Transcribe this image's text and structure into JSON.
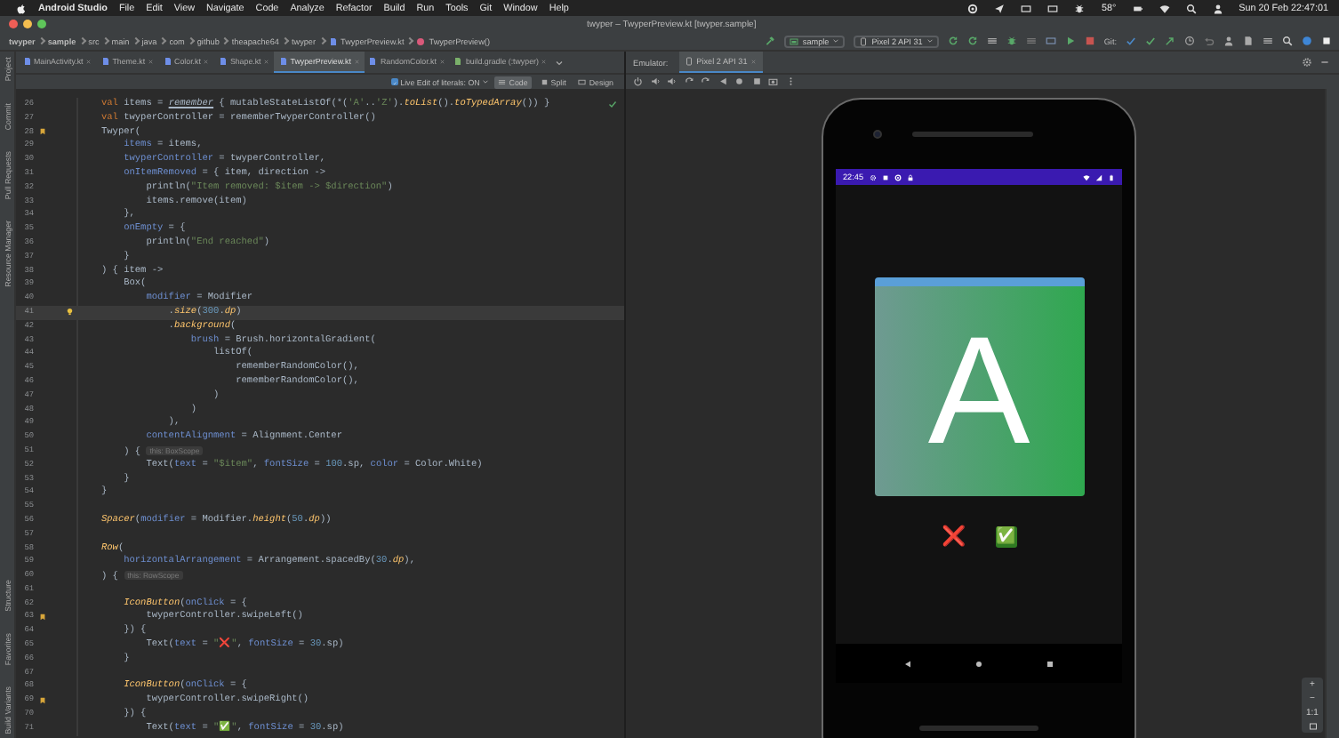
{
  "menubar": {
    "app": "Android Studio",
    "items": [
      "File",
      "Edit",
      "View",
      "Navigate",
      "Code",
      "Analyze",
      "Refactor",
      "Build",
      "Run",
      "Tools",
      "Git",
      "Window",
      "Help"
    ],
    "status_text": "58°",
    "clock": "Sun 20 Feb 22:47:01"
  },
  "window": {
    "title": "twyper – TwyperPreview.kt [twyper.sample]"
  },
  "breadcrumb": [
    "twyper",
    "sample",
    "src",
    "main",
    "java",
    "com",
    "github",
    "theapache64",
    "twyper",
    "TwyperPreview.kt",
    "TwyperPreview()"
  ],
  "run_config": {
    "module": "sample",
    "device": "Pixel 2 API 31",
    "vcs_label": "Git:"
  },
  "tool_strip": {
    "top": [
      "Project",
      "Commit",
      "Pull Requests",
      "Resource Manager"
    ],
    "bottom": [
      "Structure",
      "Favorites",
      "Build Variants"
    ]
  },
  "tabs": [
    {
      "label": "MainActivity.kt",
      "kind": "source",
      "selected": false
    },
    {
      "label": "Theme.kt",
      "kind": "source",
      "selected": false
    },
    {
      "label": "Color.kt",
      "kind": "source",
      "selected": false
    },
    {
      "label": "Shape.kt",
      "kind": "source",
      "selected": false
    },
    {
      "label": "TwyperPreview.kt",
      "kind": "source",
      "selected": true
    },
    {
      "label": "RandomColor.kt",
      "kind": "source",
      "selected": false
    },
    {
      "label": "build.gradle (:twyper)",
      "kind": "gradle",
      "selected": false
    }
  ],
  "editor_toolbar": {
    "live_edit": {
      "label": "Live Edit of literals: ON",
      "checked": true
    },
    "modes": [
      {
        "label": "Code",
        "selected": true
      },
      {
        "label": "Split",
        "selected": false
      },
      {
        "label": "Design",
        "selected": false
      }
    ]
  },
  "code_lines": [
    {
      "number": "26",
      "bookmarked": false,
      "bulb": false,
      "current": false,
      "segments": [
        {
          "kind": "keyword",
          "text": "val"
        },
        {
          "kind": "plain",
          "text": " items = "
        },
        {
          "kind": "ref",
          "text": "remember"
        },
        {
          "kind": "plain",
          "text": " { mutableStateListOf(*("
        },
        {
          "kind": "string",
          "text": "'A'"
        },
        {
          "kind": "plain",
          "text": ".."
        },
        {
          "kind": "string",
          "text": "'Z'"
        },
        {
          "kind": "plain",
          "text": ")."
        },
        {
          "kind": "call",
          "text": "toList"
        },
        {
          "kind": "plain",
          "text": "()."
        },
        {
          "kind": "call",
          "text": "toTypedArray"
        },
        {
          "kind": "plain",
          "text": "()) }"
        }
      ]
    },
    {
      "number": "27",
      "bookmarked": false,
      "bulb": false,
      "current": false,
      "segments": [
        {
          "kind": "keyword",
          "text": "val"
        },
        {
          "kind": "plain",
          "text": " twyperController = rememberTwyperController()"
        }
      ]
    },
    {
      "number": "28",
      "bookmarked": true,
      "bulb": false,
      "current": false,
      "segments": [
        {
          "kind": "plain",
          "text": "Twyper("
        }
      ]
    },
    {
      "number": "29",
      "bookmarked": false,
      "bulb": false,
      "current": false,
      "segments": [
        {
          "kind": "param",
          "text": "    items"
        },
        {
          "kind": "plain",
          "text": " = items,"
        }
      ]
    },
    {
      "number": "30",
      "bookmarked": false,
      "bulb": false,
      "current": false,
      "segments": [
        {
          "kind": "param",
          "text": "    twyperController"
        },
        {
          "kind": "plain",
          "text": " = twyperController,"
        }
      ]
    },
    {
      "number": "31",
      "bookmarked": false,
      "bulb": false,
      "current": false,
      "segments": [
        {
          "kind": "param",
          "text": "    onItemRemoved"
        },
        {
          "kind": "plain",
          "text": " = { item, direction ->"
        }
      ]
    },
    {
      "number": "32",
      "bookmarked": false,
      "bulb": false,
      "current": false,
      "segments": [
        {
          "kind": "plain",
          "text": "        println("
        },
        {
          "kind": "string",
          "text": "\"Item removed: $item -> $direction\""
        },
        {
          "kind": "plain",
          "text": ")"
        }
      ]
    },
    {
      "number": "33",
      "bookmarked": false,
      "bulb": false,
      "current": false,
      "segments": [
        {
          "kind": "plain",
          "text": "        items.remove(item)"
        }
      ]
    },
    {
      "number": "34",
      "bookmarked": false,
      "bulb": false,
      "current": false,
      "segments": [
        {
          "kind": "plain",
          "text": "    },"
        }
      ]
    },
    {
      "number": "35",
      "bookmarked": false,
      "bulb": false,
      "current": false,
      "segments": [
        {
          "kind": "param",
          "text": "    onEmpty"
        },
        {
          "kind": "plain",
          "text": " = {"
        }
      ]
    },
    {
      "number": "36",
      "bookmarked": false,
      "bulb": false,
      "current": false,
      "segments": [
        {
          "kind": "plain",
          "text": "        println("
        },
        {
          "kind": "string",
          "text": "\"End reached\""
        },
        {
          "kind": "plain",
          "text": ")"
        }
      ]
    },
    {
      "number": "37",
      "bookmarked": false,
      "bulb": false,
      "current": false,
      "segments": [
        {
          "kind": "plain",
          "text": "    }"
        }
      ]
    },
    {
      "number": "38",
      "bookmarked": false,
      "bulb": false,
      "current": false,
      "segments": [
        {
          "kind": "plain",
          "text": ") { item ->"
        }
      ]
    },
    {
      "number": "39",
      "bookmarked": false,
      "bulb": false,
      "current": false,
      "segments": [
        {
          "kind": "plain",
          "text": "    Box("
        }
      ]
    },
    {
      "number": "40",
      "bookmarked": false,
      "bulb": false,
      "current": false,
      "segments": [
        {
          "kind": "param",
          "text": "        modifier"
        },
        {
          "kind": "plain",
          "text": " = Modifier"
        }
      ]
    },
    {
      "number": "41",
      "bookmarked": false,
      "bulb": true,
      "current": true,
      "segments": [
        {
          "kind": "plain",
          "text": "            ."
        },
        {
          "kind": "call",
          "text": "size"
        },
        {
          "kind": "plain",
          "text": "("
        },
        {
          "kind": "number",
          "text": "300"
        },
        {
          "kind": "plain",
          "text": "."
        },
        {
          "kind": "call",
          "text": "dp"
        },
        {
          "kind": "plain",
          "text": ")"
        }
      ]
    },
    {
      "number": "42",
      "bookmarked": false,
      "bulb": false,
      "current": false,
      "segments": [
        {
          "kind": "plain",
          "text": "            ."
        },
        {
          "kind": "call",
          "text": "background"
        },
        {
          "kind": "plain",
          "text": "("
        }
      ]
    },
    {
      "number": "43",
      "bookmarked": false,
      "bulb": false,
      "current": false,
      "segments": [
        {
          "kind": "param",
          "text": "                brush"
        },
        {
          "kind": "plain",
          "text": " = Brush.horizontalGradient("
        }
      ]
    },
    {
      "number": "44",
      "bookmarked": false,
      "bulb": false,
      "current": false,
      "segments": [
        {
          "kind": "plain",
          "text": "                    listOf("
        }
      ]
    },
    {
      "number": "45",
      "bookmarked": false,
      "bulb": false,
      "current": false,
      "segments": [
        {
          "kind": "plain",
          "text": "                        rememberRandomColor(),"
        }
      ]
    },
    {
      "number": "46",
      "bookmarked": false,
      "bulb": false,
      "current": false,
      "segments": [
        {
          "kind": "plain",
          "text": "                        rememberRandomColor(),"
        }
      ]
    },
    {
      "number": "47",
      "bookmarked": false,
      "bulb": false,
      "current": false,
      "segments": [
        {
          "kind": "plain",
          "text": "                    )"
        }
      ]
    },
    {
      "number": "48",
      "bookmarked": false,
      "bulb": false,
      "current": false,
      "segments": [
        {
          "kind": "plain",
          "text": "                )"
        }
      ]
    },
    {
      "number": "49",
      "bookmarked": false,
      "bulb": false,
      "current": false,
      "segments": [
        {
          "kind": "plain",
          "text": "            ),"
        }
      ]
    },
    {
      "number": "50",
      "bookmarked": false,
      "bulb": false,
      "current": false,
      "segments": [
        {
          "kind": "param",
          "text": "        contentAlignment"
        },
        {
          "kind": "plain",
          "text": " = Alignment.Center"
        }
      ]
    },
    {
      "number": "51",
      "bookmarked": false,
      "bulb": false,
      "current": false,
      "segments": [
        {
          "kind": "plain",
          "text": "    ) { "
        },
        {
          "kind": "hint",
          "text": "this: BoxScope"
        }
      ]
    },
    {
      "number": "52",
      "bookmarked": false,
      "bulb": false,
      "current": false,
      "segments": [
        {
          "kind": "plain",
          "text": "        Text("
        },
        {
          "kind": "param",
          "text": "text"
        },
        {
          "kind": "plain",
          "text": " = "
        },
        {
          "kind": "string",
          "text": "\"$item\""
        },
        {
          "kind": "plain",
          "text": ", "
        },
        {
          "kind": "param",
          "text": "fontSize"
        },
        {
          "kind": "plain",
          "text": " = "
        },
        {
          "kind": "number",
          "text": "100"
        },
        {
          "kind": "plain",
          "text": ".sp, "
        },
        {
          "kind": "param",
          "text": "color"
        },
        {
          "kind": "plain",
          "text": " = Color.White)"
        }
      ]
    },
    {
      "number": "53",
      "bookmarked": false,
      "bulb": false,
      "current": false,
      "segments": [
        {
          "kind": "plain",
          "text": "    }"
        }
      ]
    },
    {
      "number": "54",
      "bookmarked": false,
      "bulb": false,
      "current": false,
      "segments": [
        {
          "kind": "plain",
          "text": "}"
        }
      ]
    },
    {
      "number": "55",
      "bookmarked": false,
      "bulb": false,
      "current": false
    },
    {
      "number": "56",
      "bookmarked": false,
      "bulb": false,
      "current": false,
      "segments": [
        {
          "kind": "call",
          "text": "Spacer"
        },
        {
          "kind": "plain",
          "text": "("
        },
        {
          "kind": "param",
          "text": "modifier"
        },
        {
          "kind": "plain",
          "text": " = Modifier."
        },
        {
          "kind": "call",
          "text": "height"
        },
        {
          "kind": "plain",
          "text": "("
        },
        {
          "kind": "number",
          "text": "50"
        },
        {
          "kind": "plain",
          "text": "."
        },
        {
          "kind": "call",
          "text": "dp"
        },
        {
          "kind": "plain",
          "text": "))"
        }
      ]
    },
    {
      "number": "57",
      "bookmarked": false,
      "bulb": false,
      "current": false
    },
    {
      "number": "58",
      "bookmarked": false,
      "bulb": false,
      "current": false,
      "segments": [
        {
          "kind": "call",
          "text": "Row"
        },
        {
          "kind": "plain",
          "text": "("
        }
      ]
    },
    {
      "number": "59",
      "bookmarked": false,
      "bulb": false,
      "current": false,
      "segments": [
        {
          "kind": "param",
          "text": "    horizontalArrangement"
        },
        {
          "kind": "plain",
          "text": " = Arrangement.spacedBy("
        },
        {
          "kind": "number",
          "text": "30"
        },
        {
          "kind": "plain",
          "text": "."
        },
        {
          "kind": "call",
          "text": "dp"
        },
        {
          "kind": "plain",
          "text": "),"
        }
      ]
    },
    {
      "number": "60",
      "bookmarked": false,
      "bulb": false,
      "current": false,
      "segments": [
        {
          "kind": "plain",
          "text": ") { "
        },
        {
          "kind": "hint",
          "text": "this: RowScope"
        }
      ]
    },
    {
      "number": "61",
      "bookmarked": false,
      "bulb": false,
      "current": false
    },
    {
      "number": "62",
      "bookmarked": false,
      "bulb": false,
      "current": false,
      "segments": [
        {
          "kind": "call",
          "text": "    IconButton"
        },
        {
          "kind": "plain",
          "text": "("
        },
        {
          "kind": "param",
          "text": "onClick"
        },
        {
          "kind": "plain",
          "text": " = {"
        }
      ]
    },
    {
      "number": "63",
      "bookmarked": true,
      "bulb": false,
      "current": false,
      "segments": [
        {
          "kind": "plain",
          "text": "        twyperController.swipeLeft()"
        }
      ]
    },
    {
      "number": "64",
      "bookmarked": false,
      "bulb": false,
      "current": false,
      "segments": [
        {
          "kind": "plain",
          "text": "    }) {"
        }
      ]
    },
    {
      "number": "65",
      "bookmarked": false,
      "bulb": false,
      "current": false,
      "segments": [
        {
          "kind": "plain",
          "text": "        Text("
        },
        {
          "kind": "param",
          "text": "text"
        },
        {
          "kind": "plain",
          "text": " = "
        },
        {
          "kind": "string",
          "text": "\"❌\""
        },
        {
          "kind": "plain",
          "text": ", "
        },
        {
          "kind": "param",
          "text": "fontSize"
        },
        {
          "kind": "plain",
          "text": " = "
        },
        {
          "kind": "number",
          "text": "30"
        },
        {
          "kind": "plain",
          "text": ".sp)"
        }
      ]
    },
    {
      "number": "66",
      "bookmarked": false,
      "bulb": false,
      "current": false,
      "segments": [
        {
          "kind": "plain",
          "text": "    }"
        }
      ]
    },
    {
      "number": "67",
      "bookmarked": false,
      "bulb": false,
      "current": false
    },
    {
      "number": "68",
      "bookmarked": false,
      "bulb": false,
      "current": false,
      "segments": [
        {
          "kind": "call",
          "text": "    IconButton"
        },
        {
          "kind": "plain",
          "text": "("
        },
        {
          "kind": "param",
          "text": "onClick"
        },
        {
          "kind": "plain",
          "text": " = {"
        }
      ]
    },
    {
      "number": "69",
      "bookmarked": true,
      "bulb": false,
      "current": false,
      "segments": [
        {
          "kind": "plain",
          "text": "        twyperController.swipeRight()"
        }
      ]
    },
    {
      "number": "70",
      "bookmarked": false,
      "bulb": false,
      "current": false,
      "segments": [
        {
          "kind": "plain",
          "text": "    }) {"
        }
      ]
    },
    {
      "number": "71",
      "bookmarked": false,
      "bulb": false,
      "current": false,
      "segments": [
        {
          "kind": "plain",
          "text": "        Text("
        },
        {
          "kind": "param",
          "text": "text"
        },
        {
          "kind": "plain",
          "text": " = "
        },
        {
          "kind": "string",
          "text": "\"✅\""
        },
        {
          "kind": "plain",
          "text": ", "
        },
        {
          "kind": "param",
          "text": "fontSize"
        },
        {
          "kind": "plain",
          "text": " = "
        },
        {
          "kind": "number",
          "text": "30"
        },
        {
          "kind": "plain",
          "text": ".sp)"
        }
      ]
    }
  ],
  "emulator": {
    "label": "Emulator:",
    "device_tab": "Pixel 2 API 31",
    "phone": {
      "time": "22:45",
      "card_letter": "A",
      "actions": [
        {
          "kind": "reject",
          "text": "❌"
        },
        {
          "kind": "accept",
          "text": "✅"
        }
      ]
    },
    "zoom": [
      "+",
      "−",
      "1:1"
    ]
  }
}
